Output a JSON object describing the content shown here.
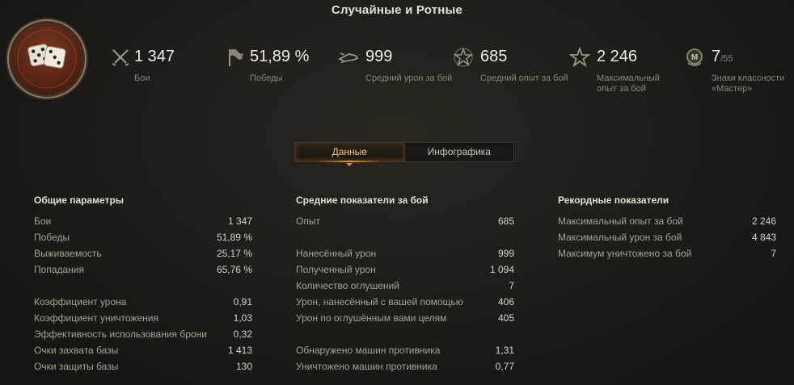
{
  "header": {
    "title": "Случайные и Ротные"
  },
  "stats": [
    {
      "icon": "crossed-swords-icon",
      "value": "1 347",
      "label": "Бои"
    },
    {
      "icon": "flag-icon",
      "value": "51,89 %",
      "label": "Победы"
    },
    {
      "icon": "shell-damage-icon",
      "value": "999",
      "label": "Средний урон за бой"
    },
    {
      "icon": "star-outline-icon",
      "value": "685",
      "label": "Средний опыт за бой"
    },
    {
      "icon": "star-icon",
      "value": "2 246",
      "label": "Максимальный опыт за бой"
    },
    {
      "icon": "mastery-badge-icon",
      "value": "7",
      "value_suffix": "/55",
      "label": "Знаки классности «Мастер»"
    }
  ],
  "tabs": {
    "data": "Данные",
    "infographic": "Инфографика"
  },
  "general": {
    "heading": "Общие параметры",
    "rows": [
      {
        "k": "Бои",
        "v": "1 347"
      },
      {
        "k": "Победы",
        "v": "51,89 %"
      },
      {
        "k": "Выживаемость",
        "v": "25,17 %"
      },
      {
        "k": "Попадания",
        "v": "65,76 %"
      },
      {
        "k": "Коэффициент урона",
        "v": "0,91"
      },
      {
        "k": "Коэффициент уничтожения",
        "v": "1,03"
      },
      {
        "k": "Эффективность использования брони",
        "v": "0,32"
      },
      {
        "k": "Очки захвата базы",
        "v": "1 413"
      },
      {
        "k": "Очки защиты базы",
        "v": "130"
      }
    ]
  },
  "average": {
    "heading": "Средние показатели за бой",
    "rows": [
      {
        "k": "Опыт",
        "v": "685"
      },
      {
        "k": "Нанесённый урон",
        "v": "999"
      },
      {
        "k": "Полученный урон",
        "v": "1 094"
      },
      {
        "k": "Количество оглушений",
        "v": "7"
      },
      {
        "k": "Урон, нанесённый с вашей помощью",
        "v": "406"
      },
      {
        "k": "Урон по оглушённым вами целям",
        "v": "405"
      },
      {
        "k": "Обнаружено машин противника",
        "v": "1,31"
      },
      {
        "k": "Уничтожено машин противника",
        "v": "0,77"
      }
    ]
  },
  "records": {
    "heading": "Рекордные показатели",
    "rows": [
      {
        "k": "Максимальный опыт за бой",
        "v": "2 246"
      },
      {
        "k": "Максимальный урон за бой",
        "v": "4 843"
      },
      {
        "k": "Максимум уничтожено за бой",
        "v": "7"
      }
    ]
  },
  "emblem": {
    "icon": "dice-icon"
  }
}
